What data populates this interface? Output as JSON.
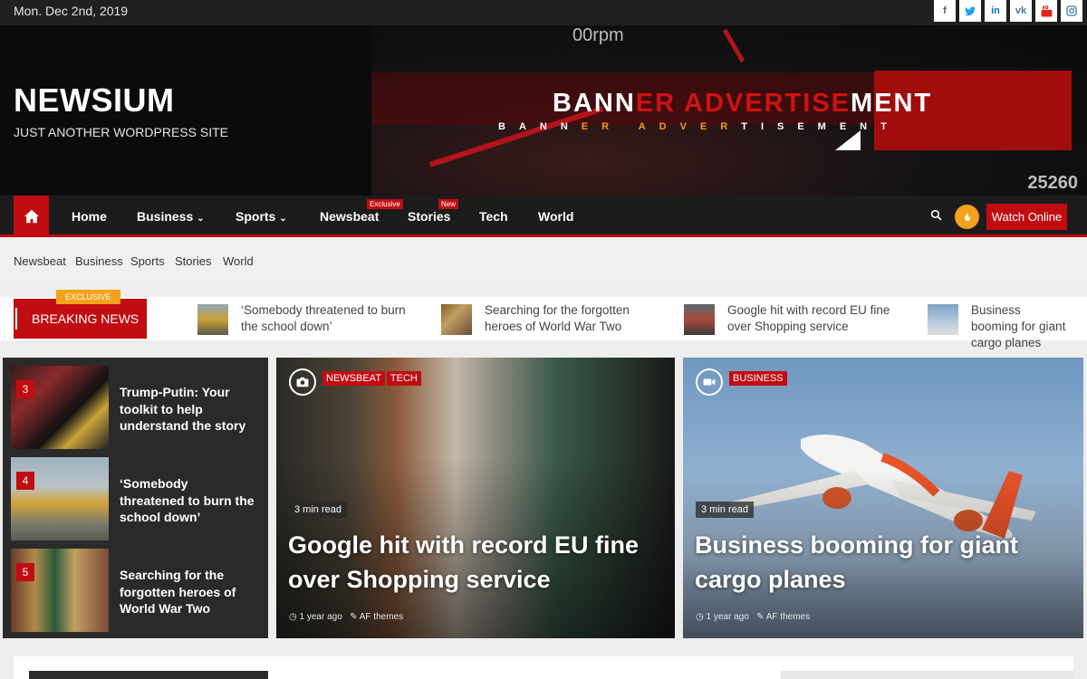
{
  "topbar": {
    "date": "Mon. Dec 2nd, 2019",
    "social": [
      {
        "icon": "facebook-icon",
        "glyph": "f",
        "color": "#3b5998"
      },
      {
        "icon": "twitter-icon",
        "glyph": "t",
        "color": "#1da1f2"
      },
      {
        "icon": "linkedin-icon",
        "glyph": "in",
        "color": "#0077b5"
      },
      {
        "icon": "vk-icon",
        "glyph": "vk",
        "color": "#4a76a8"
      },
      {
        "icon": "youtube-icon",
        "glyph": "▶",
        "color": "#e62117"
      },
      {
        "icon": "instagram-icon",
        "glyph": "◎",
        "color": "#3f729b"
      }
    ]
  },
  "header": {
    "site_name": "NEWSIUM",
    "tagline": "JUST ANOTHER WORDPRESS SITE"
  },
  "banner": {
    "title_white_1": "BANN",
    "title_red_1": "ER ADVERTISE",
    "title_white_2": "MENT",
    "subtitle_white_1": "BANN",
    "subtitle_orange": "ER ADVER",
    "subtitle_white_2": "TISEMENT",
    "rpm": "00rpm",
    "odometer": "25260"
  },
  "nav": {
    "items": [
      "Home",
      "Business",
      "Sports",
      "Newsbeat",
      "Stories",
      "Tech",
      "World"
    ],
    "badges": {
      "newsbeat": "Exclusive",
      "stories": "New"
    },
    "watch_online": "Watch Online"
  },
  "subnav": {
    "items": [
      "Newsbeat",
      "Business",
      "Sports",
      "Stories",
      "World"
    ]
  },
  "ticker": {
    "exclusive": "EXCLUSIVE",
    "breaking": "BREAKING NEWS",
    "items": [
      "‘Somebody threatened to burn the school down’",
      "Searching for the forgotten heroes of World War Two",
      "Google hit with record EU fine over Shopping service",
      "Business booming for giant cargo planes"
    ]
  },
  "trending": [
    {
      "num": "3",
      "title": "Trump-Putin: Your toolkit to help understand the story"
    },
    {
      "num": "4",
      "title": "‘Somebody threatened to burn the school down’"
    },
    {
      "num": "5",
      "title": "Searching for the forgotten heroes of World War Two"
    }
  ],
  "cards": [
    {
      "categories": [
        "NEWSBEAT",
        "TECH"
      ],
      "read_time": "3 min read",
      "title": "Google hit with record EU fine over Shopping service",
      "time": "1 year ago",
      "author": "AF themes"
    },
    {
      "categories": [
        "BUSINESS"
      ],
      "read_time": "3 min read",
      "title": "Business booming for giant cargo planes",
      "time": "1 year ago",
      "author": "AF themes"
    }
  ],
  "colors": {
    "accent": "#c10d12",
    "orange": "#f3a21b",
    "dark": "#1c1c1c"
  }
}
